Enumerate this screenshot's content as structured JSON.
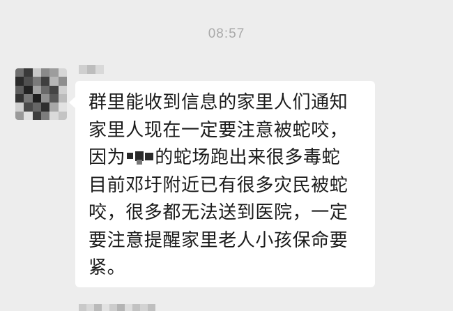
{
  "chat": {
    "timestamp": "08:57",
    "message": {
      "lines": [
        "群里能收到信息的家里人们通知",
        "家里人现在一定要注意被蛇咬，",
        "因为",
        "的蛇场跑出来很多毒蛇",
        "目前邓圩附近已有很多灾民被蛇",
        "咬，很多都无法送到医院，一定",
        "要注意提醒家里老人小孩保命要",
        "紧。"
      ]
    },
    "colors": {
      "background": "#ededed",
      "bubble": "#ffffff",
      "text": "#1b1b1b",
      "timestamp": "#a9a9a9"
    }
  }
}
